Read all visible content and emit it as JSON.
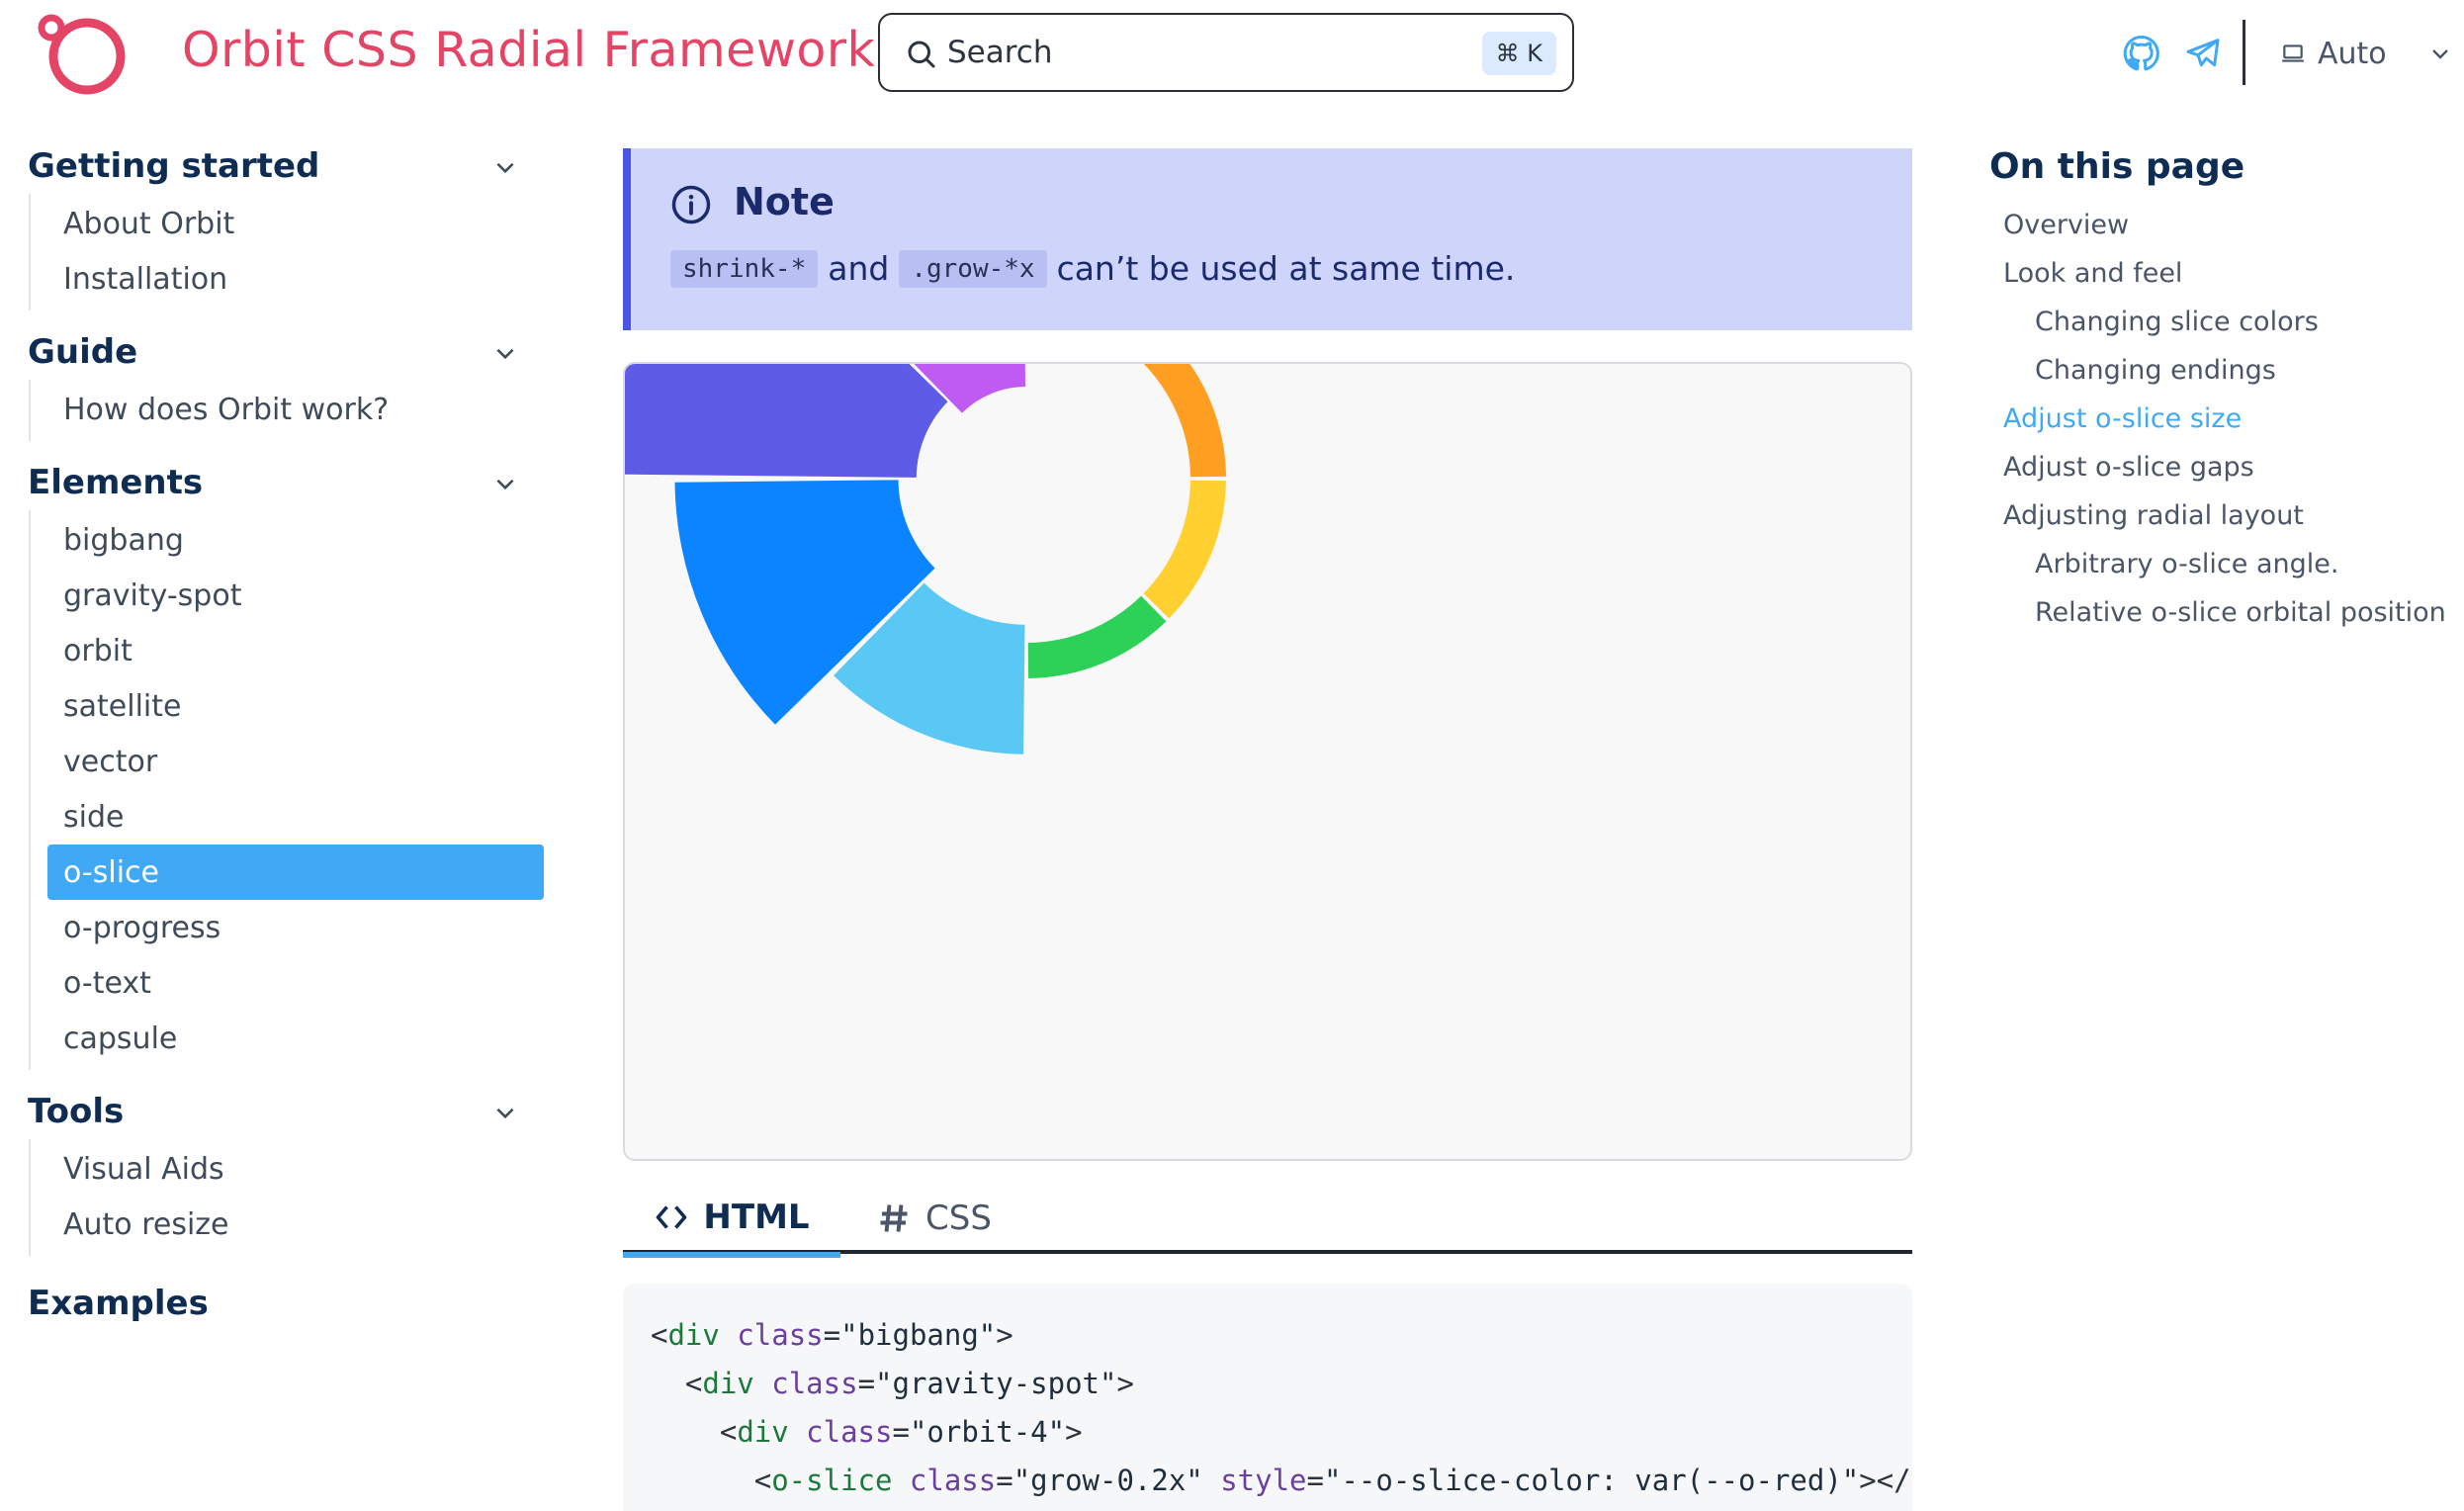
{
  "header": {
    "site_title": "Orbit CSS Radial Framework",
    "search": {
      "label": "Search",
      "shortcut": "⌘ K"
    },
    "theme": {
      "label": "Auto"
    },
    "colors": {
      "brand": "#e44466",
      "accent": "#3fa9f5"
    }
  },
  "sidebar": {
    "sections": [
      {
        "heading": "Getting started",
        "items": [
          "About Orbit",
          "Installation"
        ]
      },
      {
        "heading": "Guide",
        "items": [
          "How does Orbit work?"
        ]
      },
      {
        "heading": "Elements",
        "items": [
          "bigbang",
          "gravity-spot",
          "orbit",
          "satellite",
          "vector",
          "side",
          "o-slice",
          "o-progress",
          "o-text",
          "capsule"
        ]
      },
      {
        "heading": "Tools",
        "items": [
          "Visual Aids",
          "Auto resize"
        ]
      },
      {
        "heading": "Examples",
        "items": []
      }
    ],
    "active_item": "o-slice"
  },
  "note": {
    "title": "Note",
    "code1": "shrink-*",
    "connector": "and",
    "code2": ".grow-*x",
    "text": "can’t be used at same time."
  },
  "tabs": {
    "html": "HTML",
    "css": "CSS"
  },
  "code": {
    "lines": [
      {
        "indent": "",
        "tag": "div",
        "attr": "class",
        "value": "\"bigbang\"",
        "tail": ">"
      },
      {
        "indent": "  ",
        "tag": "div",
        "attr": "class",
        "value": "\"gravity-spot\"",
        "tail": ">"
      },
      {
        "indent": "    ",
        "tag": "div",
        "attr": "class",
        "value": "\"orbit-4\"",
        "tail": ">"
      },
      {
        "indent": "      ",
        "tag": "o-slice",
        "attr": "class",
        "value": "\"grow-0.2x\"",
        "attr2": "style",
        "value2": "\"--o-slice-color: var(--o-red)\"",
        "tail": "></o-"
      }
    ]
  },
  "toc": {
    "title": "On this page",
    "items": [
      {
        "label": "Overview",
        "level": 1
      },
      {
        "label": "Look and feel",
        "level": 1
      },
      {
        "label": "Changing slice colors",
        "level": 2
      },
      {
        "label": "Changing endings",
        "level": 2
      },
      {
        "label": "Adjust o-slice size",
        "level": 1,
        "current": true
      },
      {
        "label": "Adjust o-slice gaps",
        "level": 1
      },
      {
        "label": "Adjusting radial layout",
        "level": 1
      },
      {
        "label": "Arbitrary o-slice angle.",
        "level": 2
      },
      {
        "label": "Relative o-slice orbital position",
        "level": 2
      }
    ]
  },
  "demo_slices": [
    {
      "color_name": "red",
      "color": "#ff4136",
      "grow": 0
    },
    {
      "color_name": "orange",
      "color": "#ff9f22",
      "grow": 0
    },
    {
      "color_name": "yellow",
      "color": "#ffd030",
      "grow": 0
    },
    {
      "color_name": "green",
      "color": "#2ed158",
      "grow": 0
    },
    {
      "color_name": "light-blue",
      "color": "#5ac8f5",
      "grow": 0.2
    },
    {
      "color_name": "blue",
      "color": "#0a84ff",
      "grow": 0.4
    },
    {
      "color_name": "indigo",
      "color": "#5e5ce6",
      "grow": 0.6
    },
    {
      "color_name": "purple",
      "color": "#bf5af2",
      "grow": 0.8
    }
  ]
}
